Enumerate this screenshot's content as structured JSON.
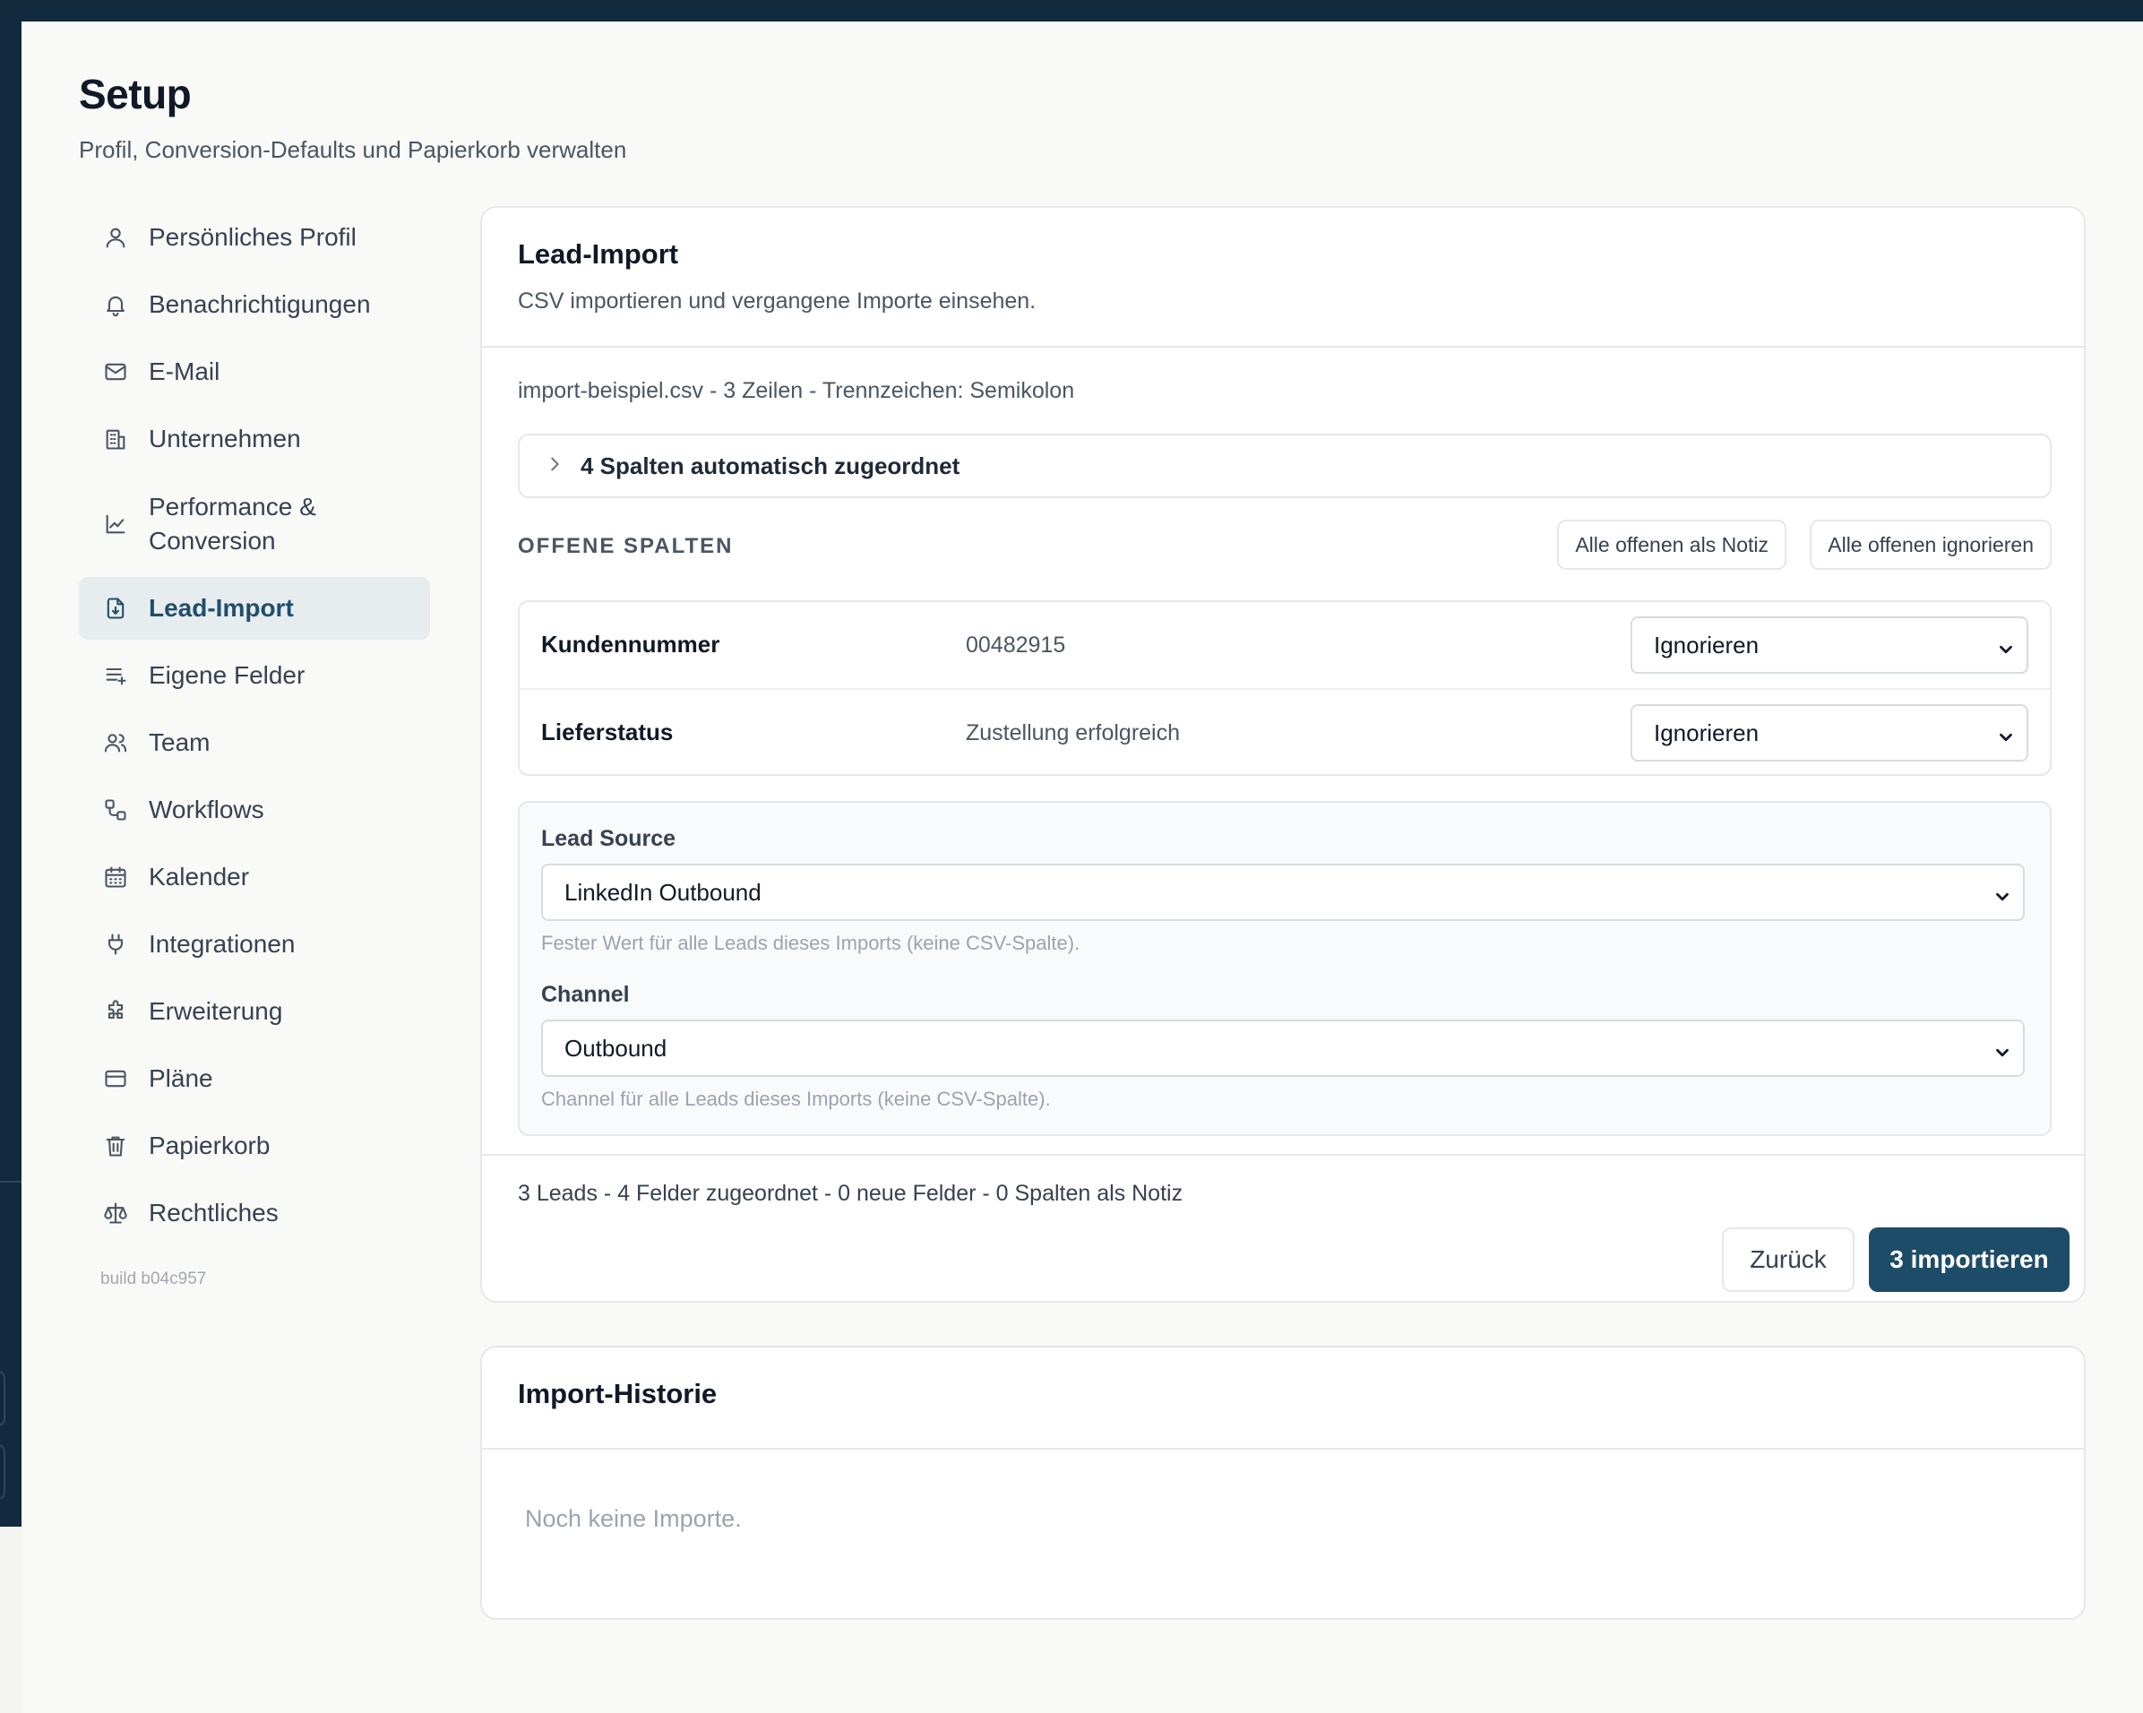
{
  "page": {
    "title": "Setup",
    "subtitle": "Profil, Conversion-Defaults und Papierkorb verwalten"
  },
  "sidebar": {
    "items": [
      {
        "label": "Persönliches Profil",
        "icon": "user-icon"
      },
      {
        "label": "Benachrichtigungen",
        "icon": "bell-icon"
      },
      {
        "label": "E-Mail",
        "icon": "mail-icon"
      },
      {
        "label": "Unternehmen",
        "icon": "building-icon"
      },
      {
        "label": "Performance & Conversion",
        "icon": "chart-line-icon"
      },
      {
        "label": "Lead-Import",
        "icon": "file-import-icon",
        "active": true
      },
      {
        "label": "Eigene Felder",
        "icon": "list-plus-icon"
      },
      {
        "label": "Team",
        "icon": "users-icon"
      },
      {
        "label": "Workflows",
        "icon": "workflow-icon"
      },
      {
        "label": "Kalender",
        "icon": "calendar-icon"
      },
      {
        "label": "Integrationen",
        "icon": "plug-icon"
      },
      {
        "label": "Erweiterung",
        "icon": "puzzle-icon"
      },
      {
        "label": "Pläne",
        "icon": "credit-card-icon"
      },
      {
        "label": "Papierkorb",
        "icon": "trash-icon"
      },
      {
        "label": "Rechtliches",
        "icon": "scale-icon"
      }
    ],
    "build": "build b04c957"
  },
  "import_card": {
    "title": "Lead-Import",
    "description": "CSV importieren und vergangene Importe einsehen.",
    "file_info": "import-beispiel.csv - 3 Zeilen - Trennzeichen: Semikolon",
    "auto_mapped": "4 Spalten automatisch zugeordnet",
    "open_columns": {
      "title": "OFFENE SPALTEN",
      "note_all_label": "Alle offenen als Notiz",
      "ignore_all_label": "Alle offenen ignorieren",
      "rows": [
        {
          "name": "Kundennummer",
          "sample": "00482915",
          "mapping": "Ignorieren"
        },
        {
          "name": "Lieferstatus",
          "sample": "Zustellung erfolgreich",
          "mapping": "Ignorieren"
        }
      ]
    },
    "lead_source": {
      "label": "Lead Source",
      "value": "LinkedIn Outbound",
      "help": "Fester Wert für alle Leads dieses Imports (keine CSV-Spalte)."
    },
    "channel": {
      "label": "Channel",
      "value": "Outbound",
      "help": "Channel für alle Leads dieses Imports (keine CSV-Spalte)."
    },
    "summary": "3 Leads - 4 Felder zugeordnet - 0 neue Felder - 0 Spalten als Notiz",
    "back_label": "Zurück",
    "import_label": "3 importieren"
  },
  "history_card": {
    "title": "Import-Historie",
    "empty": "Noch keine Importe."
  },
  "colors": {
    "frame": "#112a3d",
    "primary": "#1d4c68",
    "active_nav_bg": "#e7ecef"
  }
}
